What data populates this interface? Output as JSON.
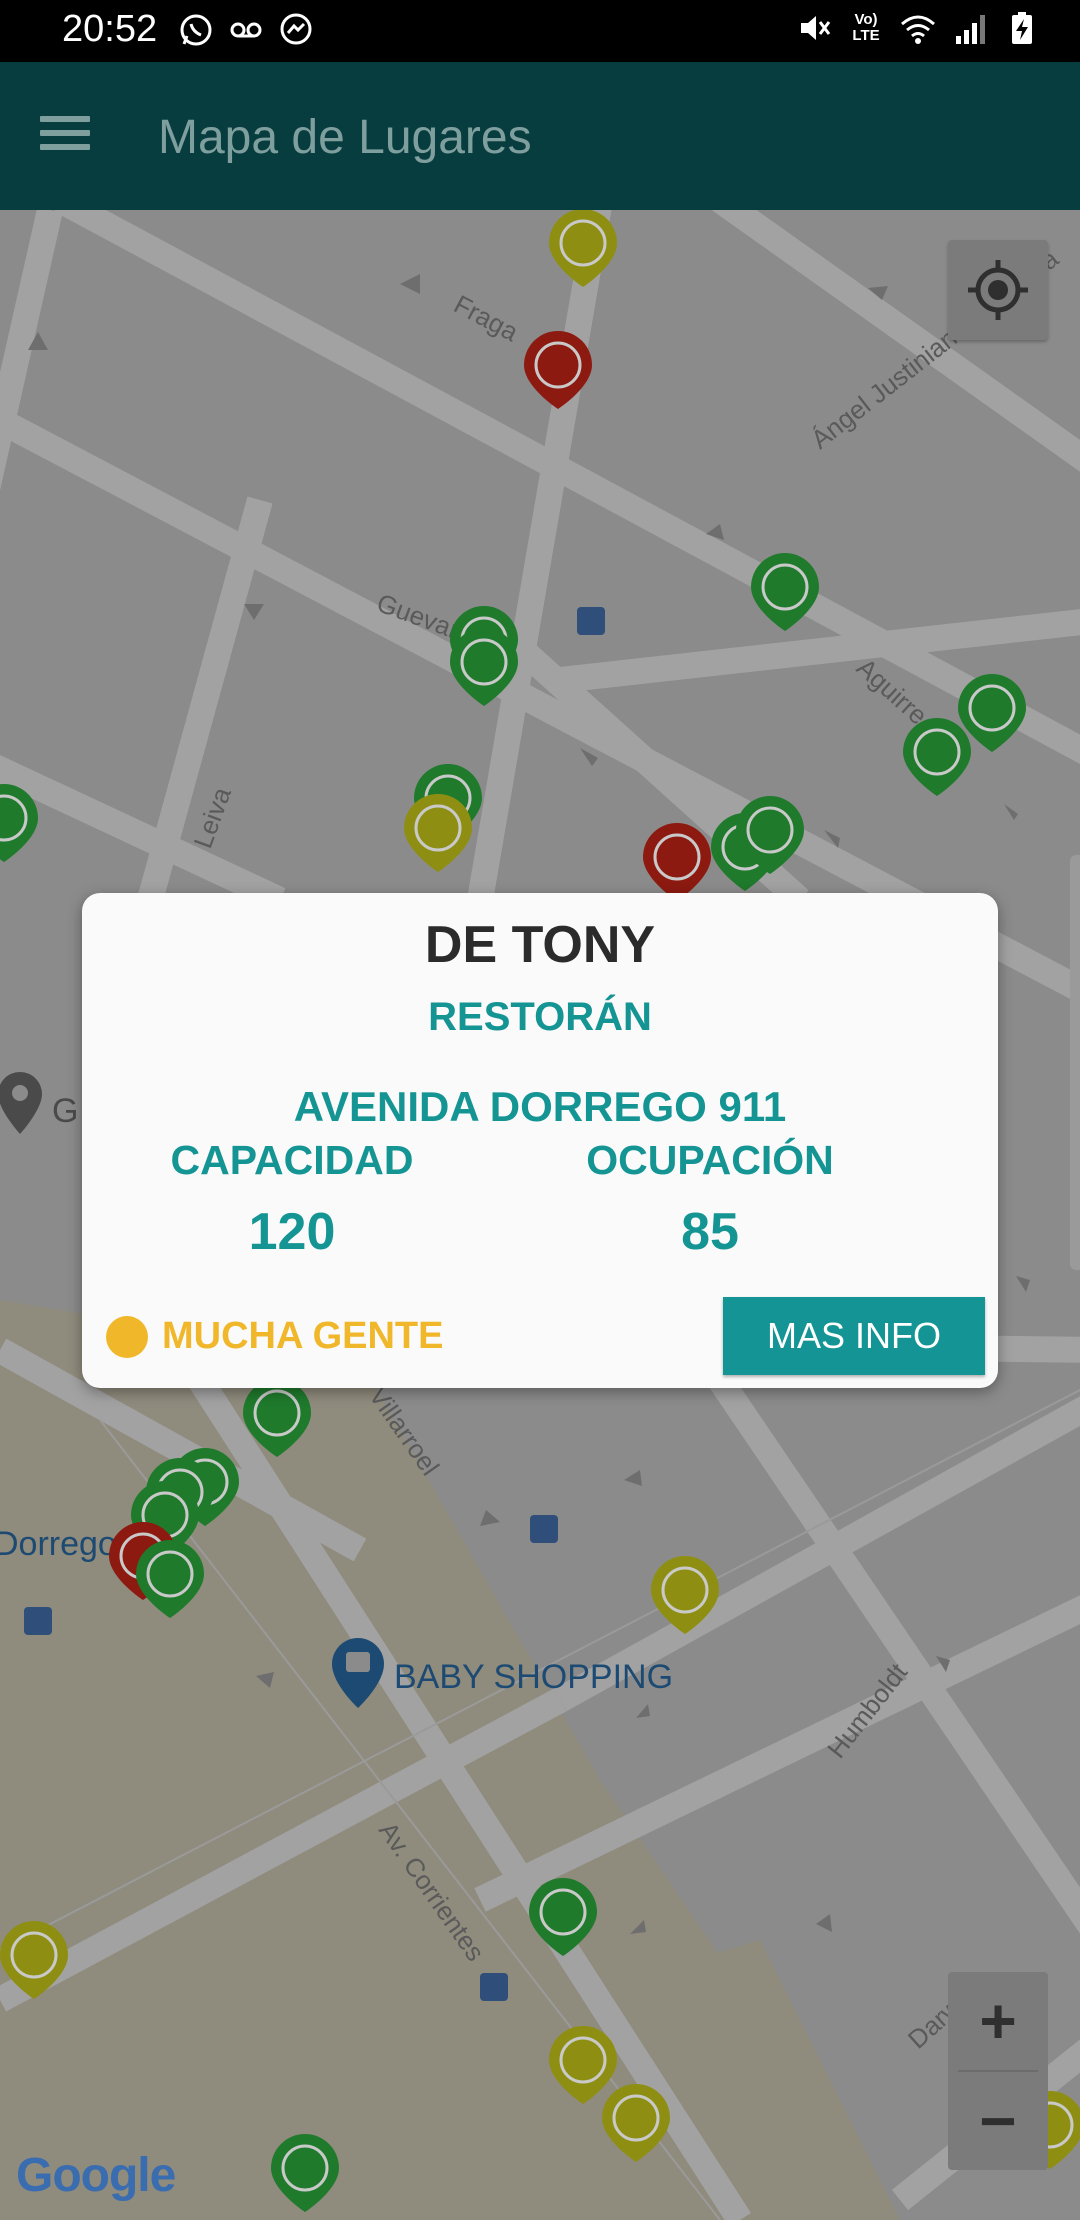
{
  "status_bar": {
    "time": "20:52",
    "left_icons": [
      "whatsapp-icon",
      "voicemail-icon",
      "messenger-icon"
    ],
    "right_icons": [
      "mute-icon",
      "volte-icon",
      "wifi-icon",
      "signal-icon",
      "battery-charging-icon"
    ],
    "volte_text": "Vo) LTE"
  },
  "app_bar": {
    "title": "Mapa de Lugares",
    "menu_icon": "hamburger-menu-icon"
  },
  "map": {
    "street_labels": [
      "Fraga",
      "Ángel Justiniano Carranza",
      "Guevara",
      "Aguirre",
      "Leiva",
      "Villarroel",
      "Av. Corrientes",
      "Humboldt",
      "Darwin",
      "Dorrego",
      "G"
    ],
    "poi_label": "BABY SHOPPING",
    "attribution": "Google",
    "zoom_in_label": "+",
    "zoom_out_label": "−",
    "marker_colors": {
      "green": "#1f7a2c",
      "red": "#8c1a10",
      "yellow": "#8e8f12"
    }
  },
  "dialog": {
    "title": "DE TONY",
    "type": "RESTORÁN",
    "address": "AVENIDA DORREGO 911",
    "capacity_label": "CAPACIDAD",
    "capacity_value": "120",
    "occupancy_label": "OCUPACIÓN",
    "occupancy_value": "85",
    "status_label": "MUCHA GENTE",
    "status_color": "#f0b72a",
    "more_button": "MAS INFO"
  }
}
